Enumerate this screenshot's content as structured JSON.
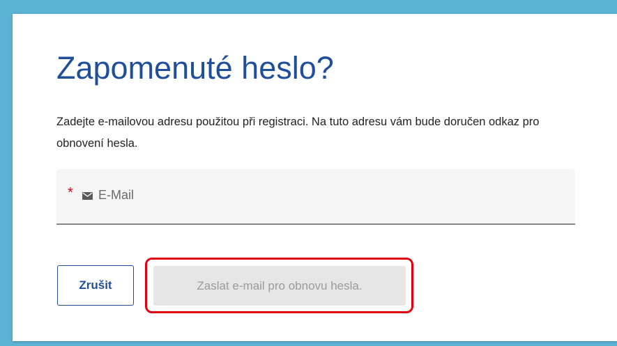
{
  "dialog": {
    "title": "Zapomenuté heslo?",
    "description": "Zadejte e-mailovou adresu použitou při registraci. Na tuto adresu vám bude doručen odkaz pro obnovení hesla.",
    "email_field": {
      "required_marker": "*",
      "icon": "mail-icon",
      "placeholder": "E-Mail",
      "value": ""
    },
    "buttons": {
      "cancel_label": "Zrušit",
      "submit_label": "Zaslat e-mail pro obnovu hesla.",
      "submit_disabled": true
    }
  },
  "colors": {
    "background": "#5bb3d4",
    "title": "#1f4e9a",
    "required": "#d0021b",
    "highlight": "#e1000f",
    "disabled_button": "#e6e6e6",
    "disabled_text": "#9b9b9b"
  }
}
